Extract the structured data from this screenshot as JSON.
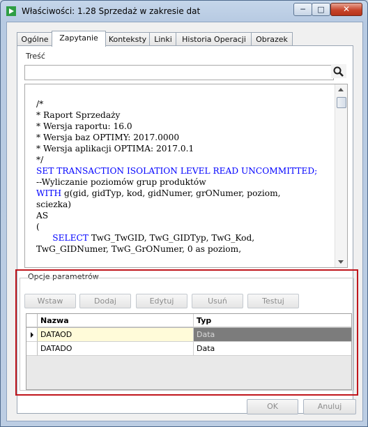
{
  "window": {
    "title": "Właściwości: 1.28 Sprzedaż w zakresie dat",
    "minimize_glyph": "─",
    "maximize_glyph": "□",
    "close_glyph": "✕"
  },
  "tabs": [
    "Ogólne",
    "Zapytanie",
    "Konteksty",
    "Linki",
    "Historia Operacji",
    "Obrazek"
  ],
  "active_tab": "Zapytanie",
  "content": {
    "group_label": "Treść",
    "search_value": "",
    "code_lines": [
      "/*",
      "* Raport Sprzedaży",
      "* Wersja raportu: 16.0",
      "* Wersja baz OPTIMY: 2017.0000",
      "* Wersja aplikacji OPTIMA: 2017.0.1",
      "*/",
      "",
      "SET TRANSACTION ISOLATION LEVEL READ UNCOMMITTED;",
      "",
      "--Wyliczanie poziomów grup produktów",
      "WITH g(gid, gidTyp, kod, gidNumer, grONumer, poziom,",
      "sciezka)",
      "AS",
      "(",
      "      SELECT TwG_TwGID, TwG_GIDTyp, TwG_Kod,",
      "TwG_GIDNumer, TwG_GrONumer, 0 as poziom,"
    ]
  },
  "params": {
    "group_label": "Opcje parametrów",
    "buttons": [
      "Wstaw",
      "Dodaj",
      "Edytuj",
      "Usuń",
      "Testuj"
    ],
    "columns": [
      "Nazwa",
      "Typ"
    ],
    "rows": [
      {
        "name": "DATAOD",
        "type": "Data",
        "selected": true
      },
      {
        "name": "DATADO",
        "type": "Data",
        "selected": false
      }
    ]
  },
  "dialog_buttons": {
    "ok": "OK",
    "cancel": "Anuluj"
  },
  "colors": {
    "highlight_frame": "#c0151c",
    "selected_name_cell": "#fffbd9",
    "selected_type_cell": "#7c7c7c",
    "keyword": "#0000ff"
  }
}
